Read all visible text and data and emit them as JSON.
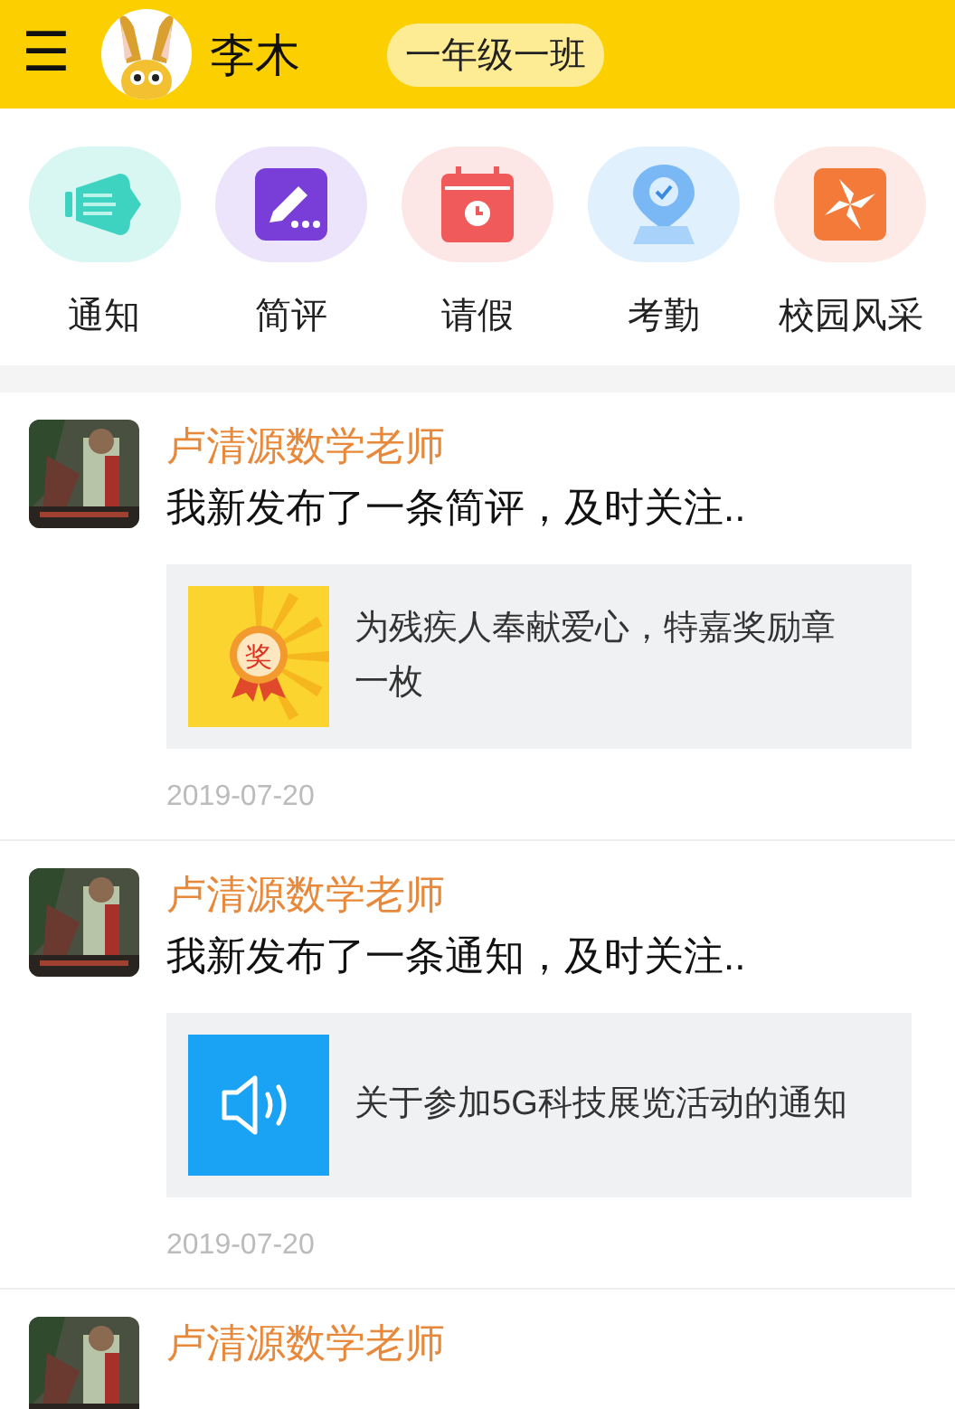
{
  "header": {
    "menu_icon": "☰",
    "user_name": "李木",
    "class_badge": "一年级一班"
  },
  "shortcuts": [
    {
      "label": "通知",
      "kind": "megaphone",
      "color": "#d8f6f2"
    },
    {
      "label": "简评",
      "kind": "pencil",
      "color": "#ece4fa"
    },
    {
      "label": "请假",
      "kind": "calendar",
      "color": "#fde6e6"
    },
    {
      "label": "考勤",
      "kind": "location",
      "color": "#e0f0fc"
    },
    {
      "label": "校园风采",
      "kind": "pinwheel",
      "color": "#fdeae6"
    }
  ],
  "posts": [
    {
      "teacher": "卢清源数学老师",
      "message": "我新发布了一条简评，及时关注..",
      "card": {
        "kind": "award",
        "text": "为残疾人奉献爱心，特嘉奖励章一枚",
        "thumb_label": "奖"
      },
      "date": "2019-07-20"
    },
    {
      "teacher": "卢清源数学老师",
      "message": "我新发布了一条通知，及时关注..",
      "card": {
        "kind": "speaker",
        "text": "关于参加5G科技展览活动的通知"
      },
      "date": "2019-07-20"
    },
    {
      "teacher": "卢清源数学老师"
    }
  ]
}
